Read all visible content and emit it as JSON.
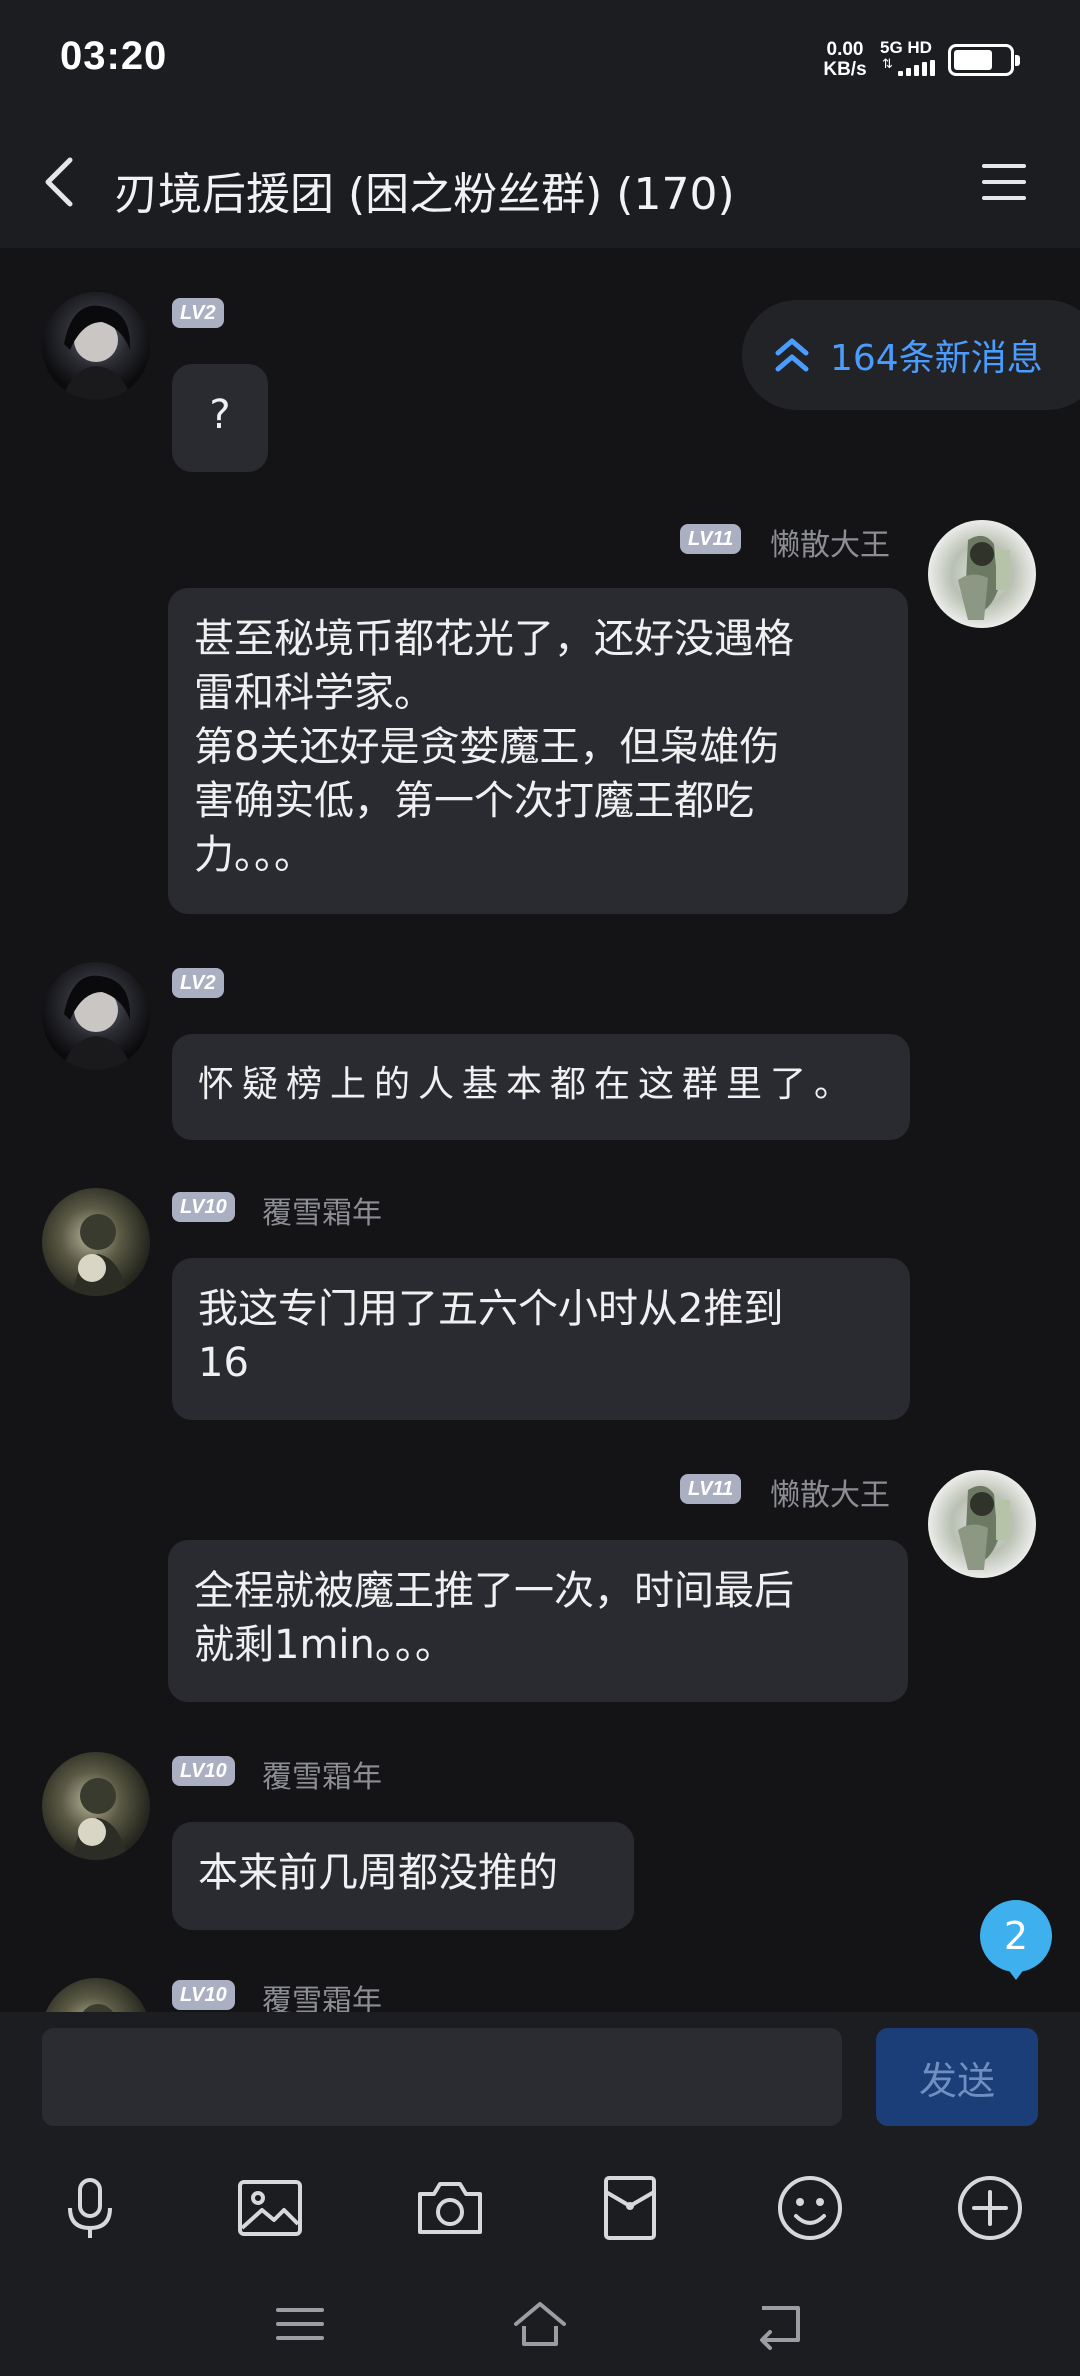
{
  "status_bar": {
    "time": "03:20",
    "net_speed_value": "0.00",
    "net_speed_unit": "KB/s",
    "network": "5G HD",
    "battery_level_percent": 70
  },
  "header": {
    "title": "刃境后援团 (困之粉丝群) (170)",
    "back_icon": "chevron-left-icon",
    "menu_icon": "menu-icon"
  },
  "new_messages_pill": {
    "label": "164条新消息",
    "color": "#4a9dff"
  },
  "messages": [
    {
      "side": "left",
      "level": "LV2",
      "nickname": "",
      "text": "?"
    },
    {
      "side": "right",
      "level": "LV11",
      "nickname": "懒散大王",
      "text": "甚至秘境币都花光了，还好没遇格\n雷和科学家。\n第8关还好是贪婪魔王，但枭雄伤\n害确实低，第一个次打魔王都吃\n力。。。"
    },
    {
      "side": "left",
      "level": "LV2",
      "nickname": "",
      "text": "怀疑榜上的人基本都在这群里了。"
    },
    {
      "side": "left",
      "level": "LV10",
      "nickname": "覆雪霜年",
      "text": "我这专门用了五六个小时从2推到\n16"
    },
    {
      "side": "right",
      "level": "LV11",
      "nickname": "懒散大王",
      "text": "全程就被魔王推了一次，时间最后\n就剩1min。。。"
    },
    {
      "side": "left",
      "level": "LV10",
      "nickname": "覆雪霜年",
      "text": "本来前几周都没推的"
    },
    {
      "side": "left",
      "level": "LV10",
      "nickname": "覆雪霜年",
      "text": ""
    }
  ],
  "unread_badge": {
    "count": "2",
    "color": "#3fb0ee"
  },
  "composer": {
    "input_placeholder": "",
    "send_label": "发送",
    "tools": [
      "microphone-icon",
      "image-icon",
      "camera-icon",
      "red-packet-icon",
      "emoji-icon",
      "plus-icon"
    ]
  },
  "nav_bar": [
    "menu-icon",
    "home-icon",
    "back-icon"
  ]
}
